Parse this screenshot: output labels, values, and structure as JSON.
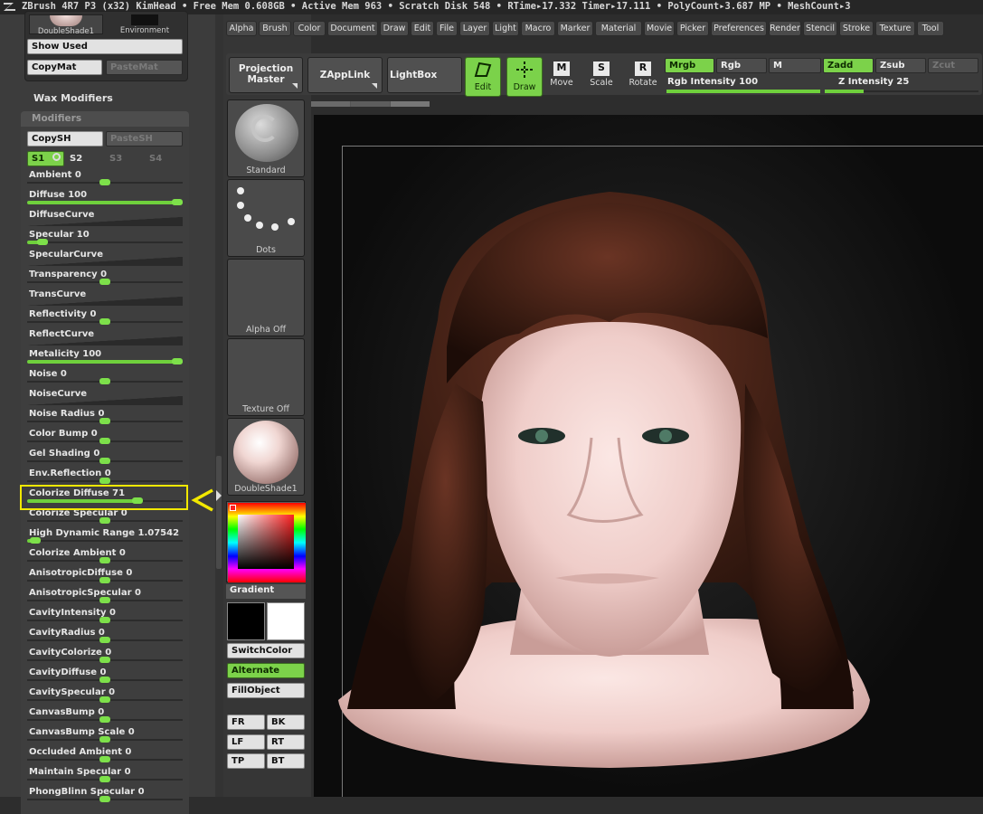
{
  "titlebar": {
    "text": "ZBrush 4R7 P3 (x32)   KimHead    • Free Mem 0.608GB • Active Mem 963 • Scratch Disk 548 •  RTime▸17.332 Timer▸17.111 • PolyCount▸3.687 MP  • MeshCount▸3"
  },
  "left": {
    "material_thumb_label": "DoubleShade1",
    "environment_label": "Environment",
    "show_used": "Show Used",
    "copymat": "CopyMat",
    "pastemat": "PasteMat",
    "wax_modifiers": "Wax Modifiers",
    "modifiers_title": "Modifiers",
    "copysh": "CopySH",
    "pastesh": "PasteSH",
    "s1": "S1",
    "s2": "S2",
    "s3": "S3",
    "s4": "S4",
    "sliders": [
      {
        "label": "Ambient 0",
        "value": 0,
        "kind": "slider"
      },
      {
        "label": "Diffuse 100",
        "value": 1.0,
        "kind": "slider"
      },
      {
        "label": "DiffuseCurve",
        "kind": "curve"
      },
      {
        "label": "Specular 10",
        "value": 0.1,
        "kind": "slider"
      },
      {
        "label": "SpecularCurve",
        "kind": "curve"
      },
      {
        "label": "Transparency 0",
        "value": 0,
        "kind": "slider"
      },
      {
        "label": "TransCurve",
        "kind": "curve"
      },
      {
        "label": "Reflectivity 0",
        "value": 0,
        "kind": "slider"
      },
      {
        "label": "ReflectCurve",
        "kind": "curve"
      },
      {
        "label": "Metalicity 100",
        "value": 1.0,
        "kind": "slider"
      },
      {
        "label": "Noise 0",
        "value": 0,
        "kind": "slider"
      },
      {
        "label": "NoiseCurve",
        "kind": "curve"
      },
      {
        "label": "Noise Radius 0",
        "value": 0,
        "kind": "slider"
      },
      {
        "label": "Color Bump 0",
        "value": 0,
        "kind": "slider"
      },
      {
        "label": "Gel Shading 0",
        "value": 0,
        "kind": "slider"
      },
      {
        "label": "Env.Reflection 0",
        "value": 0,
        "kind": "slider"
      },
      {
        "label": "Colorize Diffuse 71",
        "value": 0.71,
        "kind": "slider"
      },
      {
        "label": "Colorize Specular 0",
        "value": 0,
        "kind": "slider"
      },
      {
        "label": "High Dynamic Range 1.07542",
        "value": 0.05,
        "kind": "slider"
      },
      {
        "label": "Colorize Ambient 0",
        "value": 0,
        "kind": "slider"
      },
      {
        "label": "AnisotropicDiffuse 0",
        "value": 0,
        "kind": "slider"
      },
      {
        "label": "AnisotropicSpecular 0",
        "value": 0,
        "kind": "slider"
      },
      {
        "label": "CavityIntensity 0",
        "value": 0,
        "kind": "slider"
      },
      {
        "label": "CavityRadius 0",
        "value": 0,
        "kind": "slider"
      },
      {
        "label": "CavityColorize 0",
        "value": 0,
        "kind": "slider"
      },
      {
        "label": "CavityDiffuse 0",
        "value": 0,
        "kind": "slider"
      },
      {
        "label": "CavitySpecular 0",
        "value": 0,
        "kind": "slider"
      },
      {
        "label": "CanvasBump 0",
        "value": 0,
        "kind": "slider"
      },
      {
        "label": "CanvasBump Scale 0",
        "value": 0,
        "kind": "slider"
      },
      {
        "label": "Occluded  Ambient 0",
        "value": 0,
        "kind": "slider"
      },
      {
        "label": "Maintain Specular 0",
        "value": 0,
        "kind": "slider"
      },
      {
        "label": "PhongBlinn Specular 0",
        "value": 0,
        "kind": "slider"
      }
    ]
  },
  "shelf": {
    "brush": "Standard",
    "stroke": "Dots",
    "alpha": "Alpha Off",
    "texture": "Texture Off",
    "material": "DoubleShade1",
    "gradient": "Gradient",
    "switchcolor": "SwitchColor",
    "alternate": "Alternate",
    "fillobject": "FillObject",
    "views": [
      "FR",
      "BK",
      "LF",
      "RT",
      "TP",
      "BT"
    ]
  },
  "menu": [
    "Alpha",
    "Brush",
    "Color",
    "Document",
    "Draw",
    "Edit",
    "File",
    "Layer",
    "Light",
    "Macro",
    "Marker",
    "Material",
    "Movie",
    "Picker",
    "Preferences",
    "Render",
    "Stencil",
    "Stroke",
    "Texture",
    "Tool"
  ],
  "toolbar": {
    "projection_master": "Projection Master",
    "zapplink": "ZAppLink",
    "lightbox": "LightBox",
    "edit": "Edit",
    "draw": "Draw",
    "move": "Move",
    "scale": "Scale",
    "rotate": "Rotate",
    "mrgb": "Mrgb",
    "rgb": "Rgb",
    "m": "M",
    "zadd": "Zadd",
    "zsub": "Zsub",
    "zcut": "Zcut",
    "rgb_intensity": "Rgb Intensity 100",
    "z_intensity": "Z Intensity 25",
    "rgb_intensity_value": 1.0,
    "z_intensity_value": 0.25
  },
  "colors": {
    "accent_green": "#7cd24a",
    "highlight": "#f2e800",
    "skin": "#f1d2cf",
    "hair": "#3a1c12"
  }
}
